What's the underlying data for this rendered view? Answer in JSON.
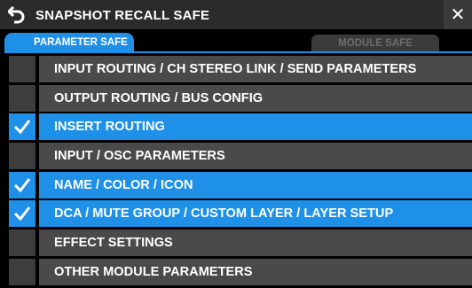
{
  "window": {
    "title": "SNAPSHOT RECALL SAFE",
    "accent_color": "#1e90e8",
    "close_label": "✕"
  },
  "tabs": [
    {
      "label": "PARAMETER SAFE",
      "active": true
    },
    {
      "label": "MODULE SAFE",
      "active": false
    }
  ],
  "items": [
    {
      "label": "INPUT ROUTING / CH STEREO LINK / SEND PARAMETERS",
      "checked": false
    },
    {
      "label": "OUTPUT ROUTING / BUS CONFIG",
      "checked": false
    },
    {
      "label": "INSERT ROUTING",
      "checked": true
    },
    {
      "label": "INPUT / OSC PARAMETERS",
      "checked": false
    },
    {
      "label": "NAME / COLOR / ICON",
      "checked": true
    },
    {
      "label": "DCA / MUTE GROUP / CUSTOM LAYER / LAYER SETUP",
      "checked": true
    },
    {
      "label": "EFFECT SETTINGS",
      "checked": false
    },
    {
      "label": "OTHER MODULE PARAMETERS",
      "checked": false
    }
  ]
}
